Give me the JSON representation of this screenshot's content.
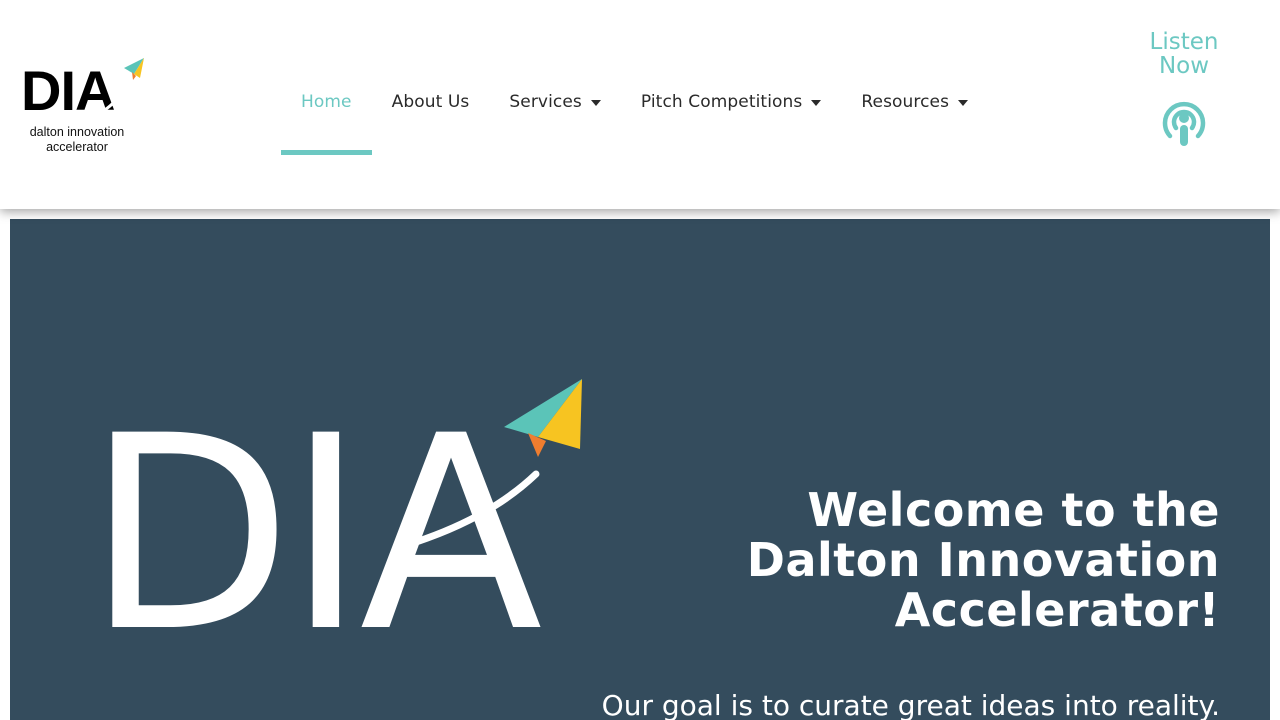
{
  "colors": {
    "accent": "#6cc8c2",
    "hero_background": "#344c5d",
    "logo_teal": "#5bc4b8",
    "logo_yellow": "#f7c421",
    "logo_orange": "#ef7d2f"
  },
  "header": {
    "logo": {
      "mark_text": "DIA",
      "caption_line1": "dalton innovation",
      "caption_line2": "accelerator"
    },
    "nav": [
      {
        "label": "Home",
        "active": true,
        "has_dropdown": false
      },
      {
        "label": "About Us",
        "active": false,
        "has_dropdown": false
      },
      {
        "label": "Services",
        "active": false,
        "has_dropdown": true
      },
      {
        "label": "Pitch Competitions",
        "active": false,
        "has_dropdown": true
      },
      {
        "label": "Resources",
        "active": false,
        "has_dropdown": true
      }
    ],
    "listen": {
      "line1": "Listen",
      "line2": "Now",
      "icon": "podcast-icon"
    }
  },
  "hero": {
    "logo_text": "DIA",
    "title_line1": "Welcome to the",
    "title_line2": "Dalton Innovation",
    "title_line3": "Accelerator!",
    "subtitle": "Our goal is to curate great ideas into reality."
  }
}
